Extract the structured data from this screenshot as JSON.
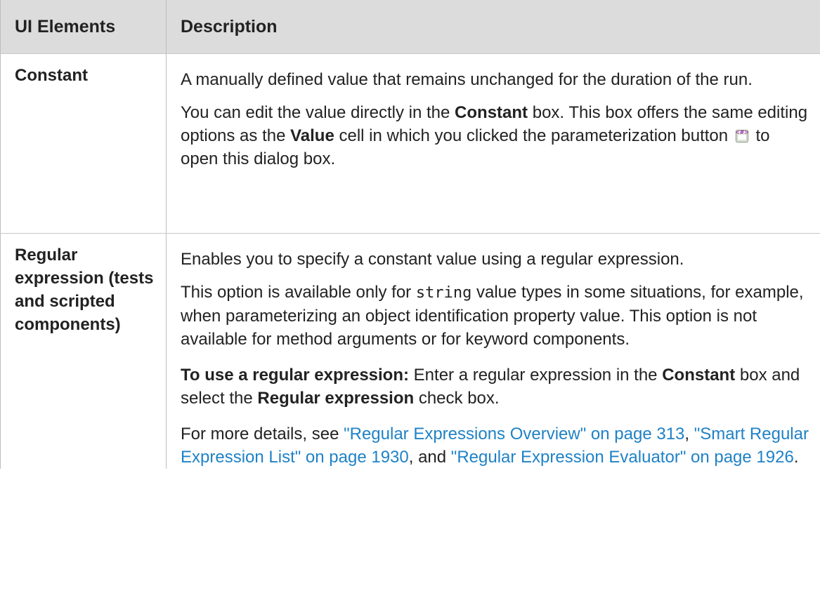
{
  "table": {
    "headers": {
      "ui_elements": "UI Elements",
      "description": "Description"
    },
    "constant_row": {
      "name": "Constant",
      "para1": "A manually defined value that remains unchanged for the duration of the run.",
      "para2_a": "You can edit the value directly in the ",
      "para2_b": "Constant",
      "para2_c": " box. This box offers the same editing options as the ",
      "para2_d": "Value",
      "para2_e": " cell in which you clicked the parameterization button ",
      "para2_f": " to open this dialog box.",
      "icon": "parameterization-button-icon"
    },
    "regex_row": {
      "name": "Regular expression (tests and scripted components)",
      "para1": "Enables you to specify a constant value using a regular expression.",
      "para2_a": "This option is available only for ",
      "para2_code": "string",
      "para2_b": " value types in some situations, for example, when parameterizing an object identification property value. This option is not available for method arguments or for keyword components.",
      "para3_bold": "To use a regular expression:",
      "para3_a": " Enter a regular expression in the ",
      "para3_b": "Constant",
      "para3_c": " box and select the ",
      "para3_d": "Regular expression",
      "para3_e": " check box.",
      "para4_a": "For more details, see ",
      "link1": "\"Regular Expressions Overview\" on page 313",
      "sep1": ", ",
      "link2": "\"Smart Regular Expression List\" on page 1930",
      "sep2": ", and ",
      "link3": "\"Regular Expression Evaluator\" on page 1926",
      "end": "."
    }
  },
  "colors": {
    "header_bg": "#dcdcdc",
    "link": "#1f82c6",
    "icon_purple": "#9b2fae"
  }
}
